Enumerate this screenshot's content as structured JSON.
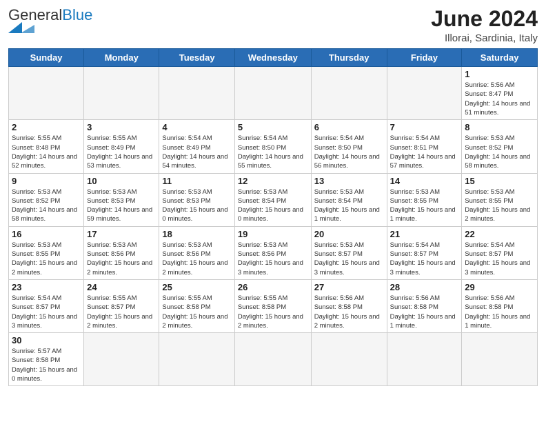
{
  "header": {
    "logo_general": "General",
    "logo_blue": "Blue",
    "title": "June 2024",
    "location": "Illorai, Sardinia, Italy"
  },
  "days_of_week": [
    "Sunday",
    "Monday",
    "Tuesday",
    "Wednesday",
    "Thursday",
    "Friday",
    "Saturday"
  ],
  "weeks": [
    [
      {
        "day": "",
        "info": ""
      },
      {
        "day": "",
        "info": ""
      },
      {
        "day": "",
        "info": ""
      },
      {
        "day": "",
        "info": ""
      },
      {
        "day": "",
        "info": ""
      },
      {
        "day": "",
        "info": ""
      },
      {
        "day": "1",
        "info": "Sunrise: 5:56 AM\nSunset: 8:47 PM\nDaylight: 14 hours and 51 minutes."
      }
    ],
    [
      {
        "day": "2",
        "info": "Sunrise: 5:55 AM\nSunset: 8:48 PM\nDaylight: 14 hours and 52 minutes."
      },
      {
        "day": "3",
        "info": "Sunrise: 5:55 AM\nSunset: 8:49 PM\nDaylight: 14 hours and 53 minutes."
      },
      {
        "day": "4",
        "info": "Sunrise: 5:54 AM\nSunset: 8:49 PM\nDaylight: 14 hours and 54 minutes."
      },
      {
        "day": "5",
        "info": "Sunrise: 5:54 AM\nSunset: 8:50 PM\nDaylight: 14 hours and 55 minutes."
      },
      {
        "day": "6",
        "info": "Sunrise: 5:54 AM\nSunset: 8:50 PM\nDaylight: 14 hours and 56 minutes."
      },
      {
        "day": "7",
        "info": "Sunrise: 5:54 AM\nSunset: 8:51 PM\nDaylight: 14 hours and 57 minutes."
      },
      {
        "day": "8",
        "info": "Sunrise: 5:53 AM\nSunset: 8:52 PM\nDaylight: 14 hours and 58 minutes."
      }
    ],
    [
      {
        "day": "9",
        "info": "Sunrise: 5:53 AM\nSunset: 8:52 PM\nDaylight: 14 hours and 58 minutes."
      },
      {
        "day": "10",
        "info": "Sunrise: 5:53 AM\nSunset: 8:53 PM\nDaylight: 14 hours and 59 minutes."
      },
      {
        "day": "11",
        "info": "Sunrise: 5:53 AM\nSunset: 8:53 PM\nDaylight: 15 hours and 0 minutes."
      },
      {
        "day": "12",
        "info": "Sunrise: 5:53 AM\nSunset: 8:54 PM\nDaylight: 15 hours and 0 minutes."
      },
      {
        "day": "13",
        "info": "Sunrise: 5:53 AM\nSunset: 8:54 PM\nDaylight: 15 hours and 1 minute."
      },
      {
        "day": "14",
        "info": "Sunrise: 5:53 AM\nSunset: 8:55 PM\nDaylight: 15 hours and 1 minute."
      },
      {
        "day": "15",
        "info": "Sunrise: 5:53 AM\nSunset: 8:55 PM\nDaylight: 15 hours and 2 minutes."
      }
    ],
    [
      {
        "day": "16",
        "info": "Sunrise: 5:53 AM\nSunset: 8:55 PM\nDaylight: 15 hours and 2 minutes."
      },
      {
        "day": "17",
        "info": "Sunrise: 5:53 AM\nSunset: 8:56 PM\nDaylight: 15 hours and 2 minutes."
      },
      {
        "day": "18",
        "info": "Sunrise: 5:53 AM\nSunset: 8:56 PM\nDaylight: 15 hours and 2 minutes."
      },
      {
        "day": "19",
        "info": "Sunrise: 5:53 AM\nSunset: 8:56 PM\nDaylight: 15 hours and 3 minutes."
      },
      {
        "day": "20",
        "info": "Sunrise: 5:53 AM\nSunset: 8:57 PM\nDaylight: 15 hours and 3 minutes."
      },
      {
        "day": "21",
        "info": "Sunrise: 5:54 AM\nSunset: 8:57 PM\nDaylight: 15 hours and 3 minutes."
      },
      {
        "day": "22",
        "info": "Sunrise: 5:54 AM\nSunset: 8:57 PM\nDaylight: 15 hours and 3 minutes."
      }
    ],
    [
      {
        "day": "23",
        "info": "Sunrise: 5:54 AM\nSunset: 8:57 PM\nDaylight: 15 hours and 3 minutes."
      },
      {
        "day": "24",
        "info": "Sunrise: 5:55 AM\nSunset: 8:57 PM\nDaylight: 15 hours and 2 minutes."
      },
      {
        "day": "25",
        "info": "Sunrise: 5:55 AM\nSunset: 8:58 PM\nDaylight: 15 hours and 2 minutes."
      },
      {
        "day": "26",
        "info": "Sunrise: 5:55 AM\nSunset: 8:58 PM\nDaylight: 15 hours and 2 minutes."
      },
      {
        "day": "27",
        "info": "Sunrise: 5:56 AM\nSunset: 8:58 PM\nDaylight: 15 hours and 2 minutes."
      },
      {
        "day": "28",
        "info": "Sunrise: 5:56 AM\nSunset: 8:58 PM\nDaylight: 15 hours and 1 minute."
      },
      {
        "day": "29",
        "info": "Sunrise: 5:56 AM\nSunset: 8:58 PM\nDaylight: 15 hours and 1 minute."
      }
    ],
    [
      {
        "day": "30",
        "info": "Sunrise: 5:57 AM\nSunset: 8:58 PM\nDaylight: 15 hours and 0 minutes."
      },
      {
        "day": "",
        "info": ""
      },
      {
        "day": "",
        "info": ""
      },
      {
        "day": "",
        "info": ""
      },
      {
        "day": "",
        "info": ""
      },
      {
        "day": "",
        "info": ""
      },
      {
        "day": "",
        "info": ""
      }
    ]
  ]
}
